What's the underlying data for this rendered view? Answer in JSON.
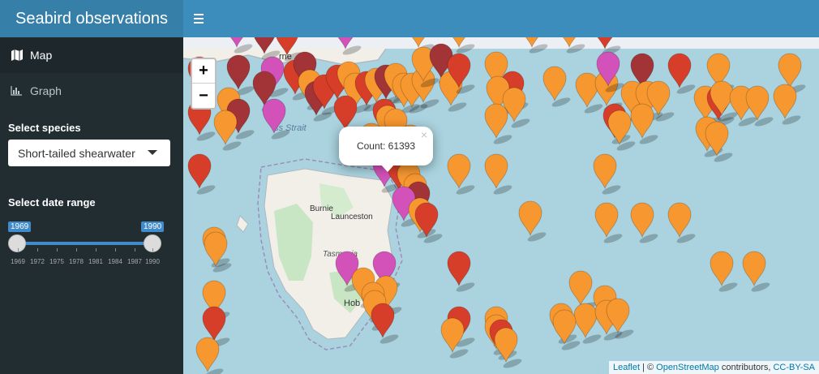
{
  "app": {
    "title": "Seabird observations"
  },
  "sidebar": {
    "items": [
      {
        "label": "Map",
        "icon": "map-icon",
        "active": true
      },
      {
        "label": "Graph",
        "icon": "bar-chart-icon",
        "active": false
      }
    ],
    "species_label": "Select species",
    "species_value": "Short-tailed shearwater",
    "date_label": "Select date range",
    "date_from": "1969",
    "date_to": "1990",
    "ticks": [
      "1969",
      "1972",
      "1975",
      "1978",
      "1981",
      "1984",
      "1987",
      "1990"
    ]
  },
  "map": {
    "zoom_in": "+",
    "zoom_out": "−",
    "popup_text": "Count: 61393",
    "popup_close": "×",
    "place_labels": [
      "Burnie",
      "Launceston",
      "Tasmania",
      "Hob",
      "ss Strait",
      "rne"
    ],
    "attribution": {
      "leaflet": "Leaflet",
      "sep": " | © ",
      "osm": "OpenStreetMap",
      "contributors": " contributors, ",
      "license": "CC-BY-SA"
    },
    "marker_colors": {
      "orange": "#f69730",
      "red": "#d63e2a",
      "darkred": "#a23336",
      "purple": "#d252b9"
    }
  }
}
